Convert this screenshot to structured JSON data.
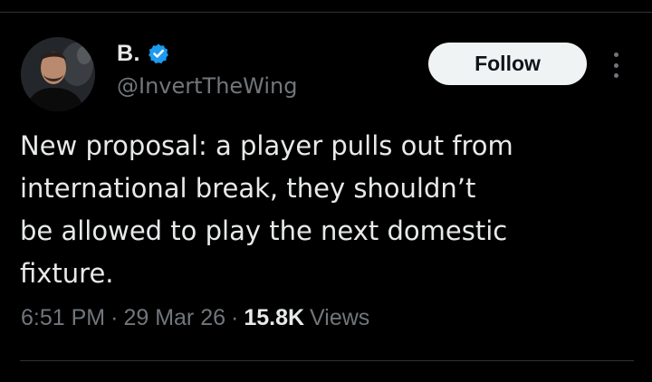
{
  "author": {
    "display_name": "B.",
    "handle": "@InvertTheWing",
    "verified": true,
    "verified_color": "#1d9bf0"
  },
  "actions": {
    "follow_label": "Follow",
    "more_icon": "more-vertical-icon"
  },
  "tweet": {
    "text": "New proposal: a player pulls out from\ninternational break, they shouldn’t\nbe allowed to play the next domestic\nfixture."
  },
  "meta": {
    "time": "6:51 PM",
    "separator": "·",
    "date": "29 Mar 26",
    "views_count": "15.8K",
    "views_label": "Views"
  },
  "colors": {
    "background": "#000000",
    "text_primary": "#e7e9ea",
    "text_secondary": "#71767b",
    "button_bg": "#eff3f4",
    "button_text": "#0f1419",
    "divider": "#2f3336"
  }
}
